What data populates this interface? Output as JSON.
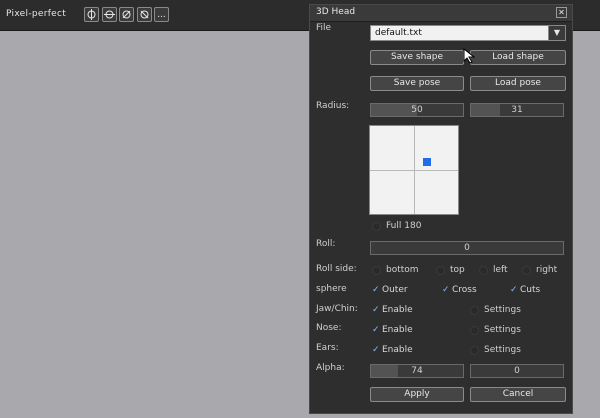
{
  "topbar": {
    "title": "Pixel-perfect",
    "tools": [
      "outline-icon",
      "crosshair-icon",
      "no-symbol-icon",
      "blocked-icon",
      "more-icon"
    ],
    "more_label": "..."
  },
  "dialog": {
    "title": "3D Head",
    "close_label": "✕",
    "file_label": "File",
    "file_value": "default.txt",
    "save_shape": "Save shape",
    "load_shape": "Load shape",
    "save_pose": "Save pose",
    "load_pose": "Load pose",
    "radius_label": "Radius:",
    "radius_a": "50",
    "radius_a_fraction": 0.5,
    "radius_b": "31",
    "radius_b_fraction": 0.31,
    "full180_label": "Full 180",
    "roll_label": "Roll:",
    "roll_value": "0",
    "roll_side_label": "Roll side:",
    "roll_side_options": [
      "bottom",
      "top",
      "left",
      "right"
    ],
    "sphere_label": "sphere",
    "sphere_options": [
      "Outer",
      "Cross",
      "Cuts"
    ],
    "jaw_label": "Jaw/Chin:",
    "nose_label": "Nose:",
    "ears_label": "Ears:",
    "enable_label": "Enable",
    "settings_label": "Settings",
    "alpha_label": "Alpha:",
    "alpha_a": "74",
    "alpha_a_fraction": 0.29,
    "alpha_b": "0",
    "alpha_b_fraction": 0,
    "apply": "Apply",
    "cancel": "Cancel"
  },
  "colors": {
    "background": "#a9a8ad",
    "panel": "#2e2e2e",
    "accent_dot": "#1f6de8"
  }
}
